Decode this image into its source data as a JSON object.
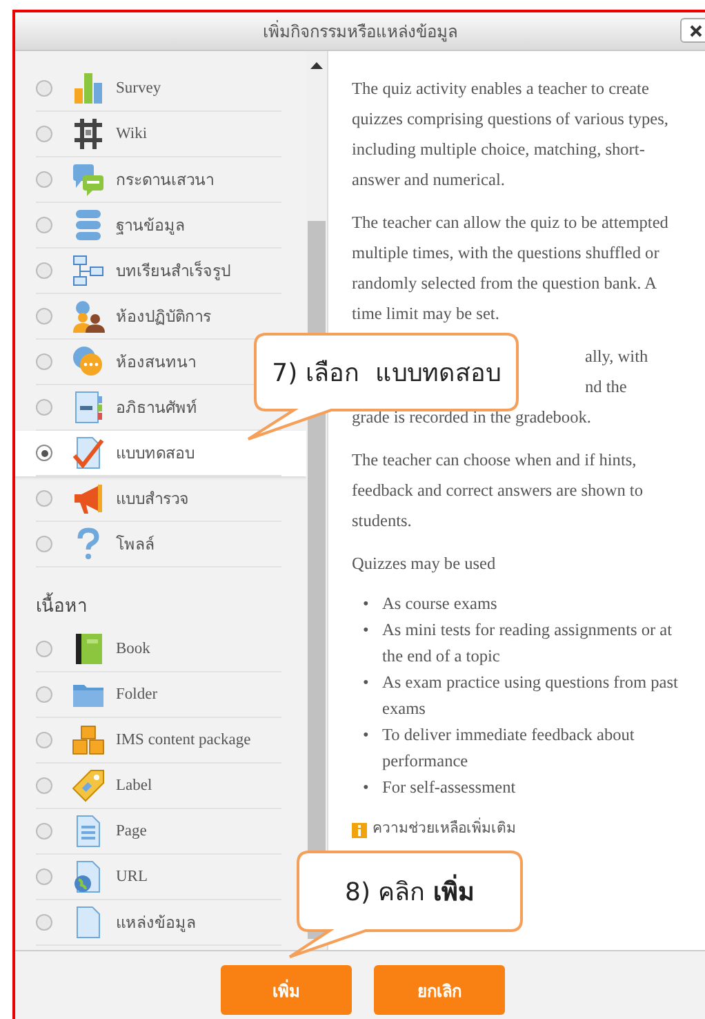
{
  "dialog": {
    "title": "เพิ่มกิจกรรมหรือแหล่งข้อมูล"
  },
  "groups": [
    {
      "items": [
        {
          "label": "Survey",
          "selected": false
        },
        {
          "label": "Wiki",
          "selected": false
        },
        {
          "label": "กระดานเสวนา",
          "selected": false
        },
        {
          "label": "ฐานข้อมูล",
          "selected": false
        },
        {
          "label": "บทเรียนสำเร็จรูป",
          "selected": false
        },
        {
          "label": "ห้องปฏิบัติการ",
          "selected": false
        },
        {
          "label": "ห้องสนทนา",
          "selected": false
        },
        {
          "label": "อภิธานศัพท์",
          "selected": false
        },
        {
          "label": "แบบทดสอบ",
          "selected": true
        },
        {
          "label": "แบบสำรวจ",
          "selected": false
        },
        {
          "label": "โพลล์",
          "selected": false
        }
      ]
    },
    {
      "heading": "เนื้อหา",
      "items": [
        {
          "label": "Book",
          "selected": false
        },
        {
          "label": "Folder",
          "selected": false
        },
        {
          "label": "IMS content package",
          "selected": false
        },
        {
          "label": "Label",
          "selected": false
        },
        {
          "label": "Page",
          "selected": false
        },
        {
          "label": "URL",
          "selected": false
        },
        {
          "label": "แหล่งข้อมูล",
          "selected": false
        }
      ]
    }
  ],
  "description": {
    "paragraphs": [
      {
        "text": "The quiz activity enables a teacher to create quizzes comprising questions of various types, including multiple choice, matching, short-answer and numerical."
      },
      {
        "text": "The teacher can allow the quiz to be attempted multiple times, with the questions shuffled or randomly selected from the question bank. A time limit may be set."
      },
      {
        "lines": [
          "ally, with",
          "nd the",
          "grade is recorded in the gradebook."
        ]
      },
      {
        "text": "The teacher can choose when and if hints, feedback and correct answers are shown to students."
      },
      {
        "text": "Quizzes may be used"
      }
    ],
    "bullets": [
      {
        "marker": "•",
        "text": "As course exams"
      },
      {
        "marker": "•",
        "text": "As mini tests for reading assignments or at the end of a topic"
      },
      {
        "marker": "•",
        "text": "As exam practice using questions from past exams"
      },
      {
        "marker": "•",
        "text": "To deliver immediate feedback about performance"
      },
      {
        "marker": "•",
        "text": "For self-assessment"
      }
    ],
    "help_link": "ความช่วยเหลือเพิ่มเติม"
  },
  "buttons": [
    "เพิ่ม",
    "ยกเลิก"
  ],
  "callouts": [
    {
      "text": "7) เลือก  แบบทดสอบ"
    },
    {
      "text": "8) คลิก **เพิ่ม**"
    }
  ]
}
